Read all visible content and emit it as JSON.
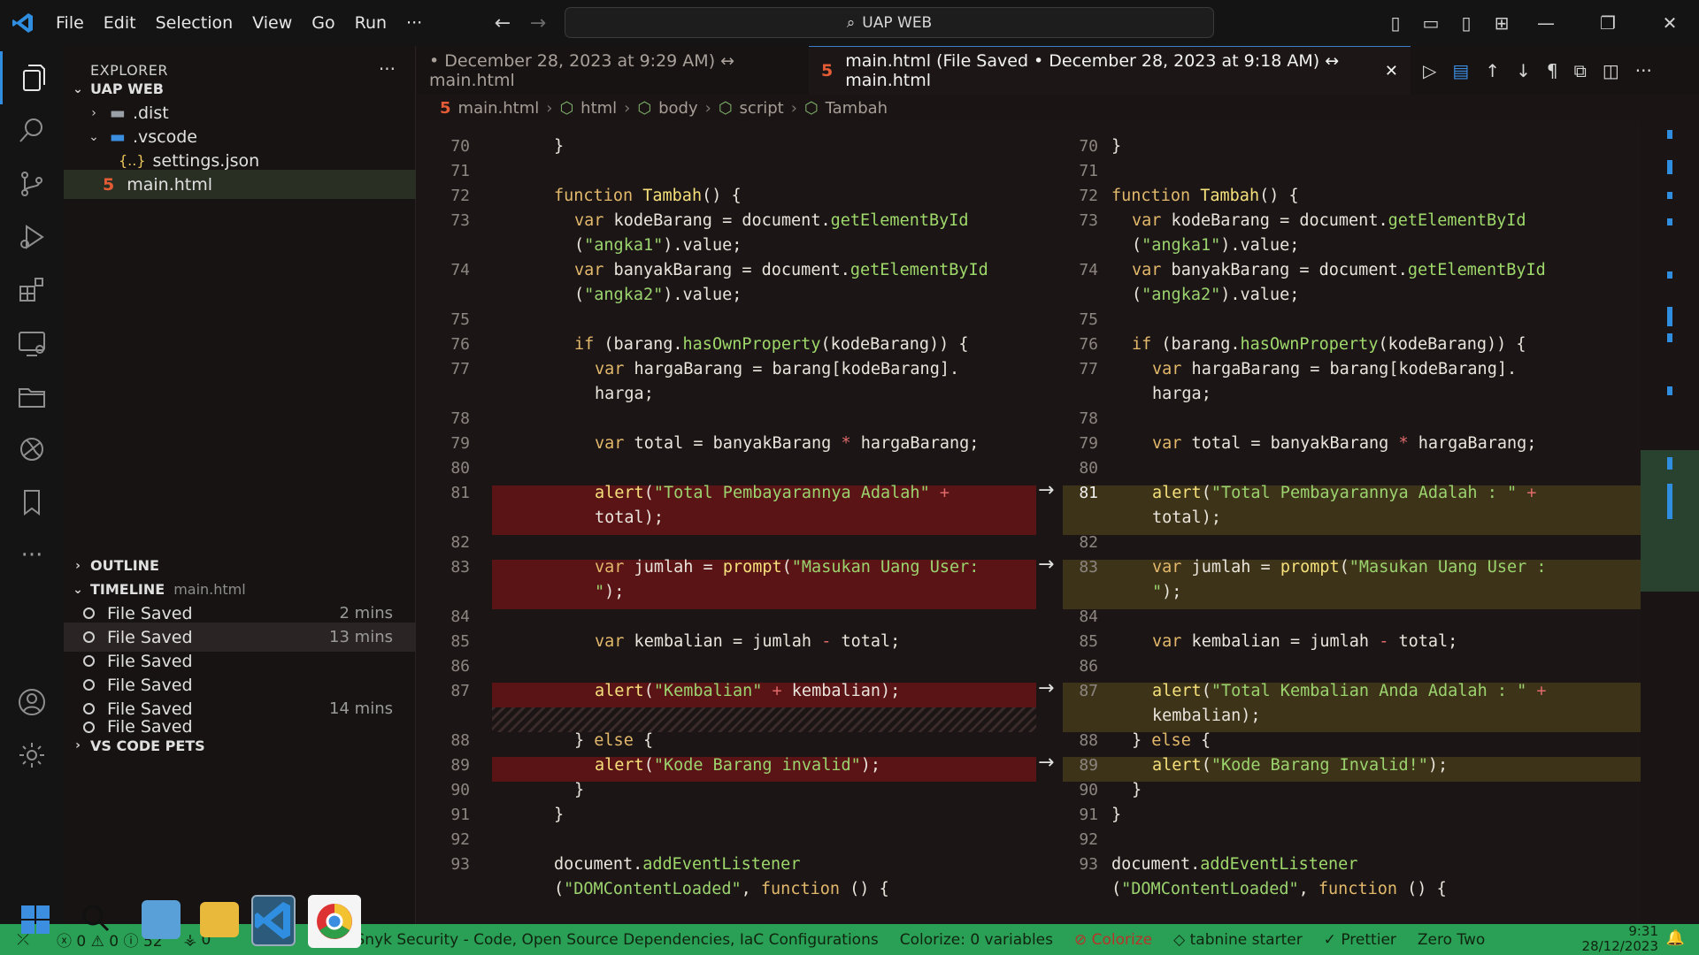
{
  "menu": [
    "File",
    "Edit",
    "Selection",
    "View",
    "Go",
    "Run",
    "···"
  ],
  "command_center": {
    "label": "UAP WEB"
  },
  "explorer": {
    "header": "EXPLORER",
    "workspace": "UAP WEB",
    "tree": [
      {
        "label": ".dist",
        "type": "folder",
        "expanded": false
      },
      {
        "label": ".vscode",
        "type": "folder",
        "expanded": true
      },
      {
        "label": "settings.json",
        "type": "json"
      },
      {
        "label": "main.html",
        "type": "html"
      }
    ]
  },
  "outline": {
    "label": "OUTLINE"
  },
  "timeline": {
    "label": "TIMELINE",
    "file": "main.html",
    "items": [
      {
        "label": "File Saved",
        "time": "2 mins"
      },
      {
        "label": "File Saved",
        "time": "13 mins"
      },
      {
        "label": "File Saved",
        "time": ""
      },
      {
        "label": "File Saved",
        "time": ""
      },
      {
        "label": "File Saved",
        "time": "14 mins"
      },
      {
        "label": "File Saved",
        "time": ""
      }
    ]
  },
  "vscode_pets": "VS CODE PETS",
  "tabs": {
    "inactive": "• December 28, 2023 at 9:29 AM) ↔ main.html",
    "active": "main.html (File Saved • December 28, 2023 at 9:18 AM) ↔ main.html"
  },
  "breadcrumb": [
    "main.html",
    "html",
    "body",
    "script",
    "Tambah"
  ],
  "status": {
    "errors": "0",
    "warnings": "0",
    "info": "52",
    "ports": "0",
    "snyk": "Snyk Security - Code, Open Source Dependencies, IaC Configurations",
    "colorize_vars": "Colorize: 0 variables",
    "colorize": "Colorize",
    "tabnine": "tabnine starter",
    "prettier": "Prettier",
    "theme": "Zero Two",
    "time": "9:31",
    "date": "28/12/2023"
  },
  "colors": {
    "accent": "#2f8ee0",
    "status_bg": "#29a055",
    "deleted_bg": "#5a1416",
    "inserted_bg": "#3d3318"
  }
}
